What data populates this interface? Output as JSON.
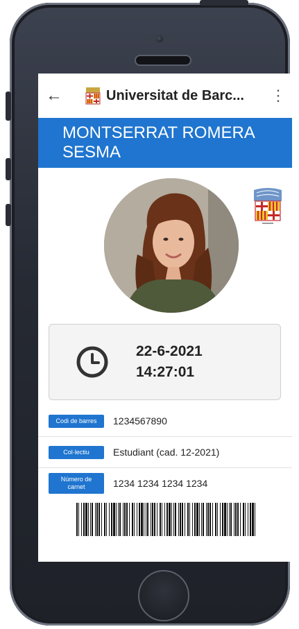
{
  "appbar": {
    "back_icon": "arrow-left-icon",
    "title": "Universitat de Barc...",
    "menu_icon": "more-vert-icon"
  },
  "student": {
    "name": "MONTSERRAT ROMERA SESMA"
  },
  "timestamp": {
    "date": "22-6-2021",
    "time": "14:27:01",
    "icon": "clock-icon"
  },
  "info": [
    {
      "label": "Codi de barres",
      "value": "1234567890"
    },
    {
      "label": "Col·lectiu",
      "value": "Estudiant (cad. 12-2021)"
    },
    {
      "label": "Número de carnet",
      "value": "1234 1234 1234 1234"
    }
  ],
  "colors": {
    "accent": "#1f75cf",
    "phone_frame": "#262a33"
  }
}
